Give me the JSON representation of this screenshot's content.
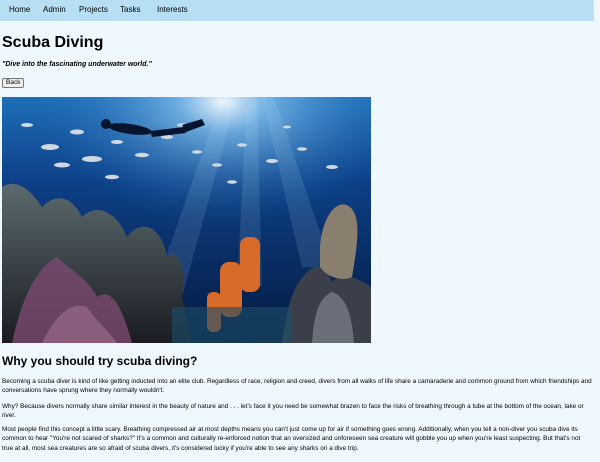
{
  "nav": {
    "items": [
      "Home",
      "Admin",
      "Projects",
      "Tasks",
      "Interests"
    ]
  },
  "page": {
    "title": "Scuba Diving",
    "tagline": "\"Dive into the fascinating underwater world.\"",
    "back_label": "Back",
    "hero_image_name": "scuba-diving-photo"
  },
  "article": {
    "heading": "Why you should try scuba diving?",
    "paragraphs": [
      "Becoming a scuba diver is kind of like getting inducted into an elite club. Regardless of race, religion and creed, divers from all walks of life share a camaraderie and common ground from which friendships and conversations have sprung where they normally wouldn't.",
      "Why? Because divers normally share similar interest in the beauty of nature and . . . let's face it you need be somewhat brazen to face the risks of breathing through a tube at the bottom of the ocean, lake or river.",
      "Most people find this concept a little scary. Breathing compressed air at most depths means you can't just come up for air if something goes wrong. Additionally, when you tell a non-diver you scuba dive its common to hear \"You're not scared of sharks?\" It's a common and culturally re-enforced notion that an oversized and unforeseen sea creature will gobble you up when you're least suspecting. But that's not true at all, most sea creatures are so afraid of scuba divers, it's considered lucky if you're able to see any sharks on a dive trip."
    ]
  },
  "colors": {
    "background": "#f0f8ff",
    "navbar": "#b6dff3",
    "water_deep": "#0a2a5c",
    "water_light": "#2f8fd0",
    "coral_orange": "#d86a2a"
  }
}
